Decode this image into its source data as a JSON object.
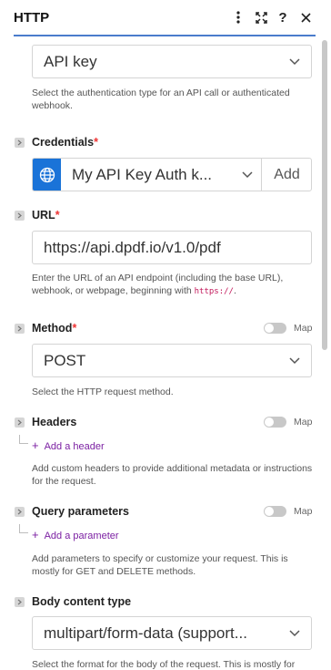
{
  "header": {
    "title": "HTTP",
    "icons": [
      "more-vertical-icon",
      "expand-icon",
      "help-icon",
      "close-icon"
    ],
    "accent_color": "#4a7ccc"
  },
  "auth_type": {
    "value": "API key",
    "help": "Select the authentication type for an API call or authenticated webhook."
  },
  "credentials": {
    "label": "Credentials",
    "required_mark": "*",
    "value": "My API Key Auth k...",
    "add_label": "Add",
    "icon_color": "#1a73d8"
  },
  "url": {
    "label": "URL",
    "required_mark": "*",
    "value": "https://api.dpdf.io/v1.0/pdf",
    "help_before": "Enter the URL of an API endpoint (including the base URL), webhook, or webpage, beginning with ",
    "help_code": "https://",
    "help_after": "."
  },
  "method": {
    "label": "Method",
    "required_mark": "*",
    "map_label": "Map",
    "value": "POST",
    "help": "Select the HTTP request method."
  },
  "headers": {
    "label": "Headers",
    "map_label": "Map",
    "add_label": "Add a header",
    "help": "Add custom headers to provide additional metadata or instructions for the request."
  },
  "query_parameters": {
    "label": "Query parameters",
    "map_label": "Map",
    "add_label": "Add a parameter",
    "help": "Add parameters to specify or customize your request. This is mostly for GET and DELETE methods."
  },
  "body_content_type": {
    "label": "Body content type",
    "value": "multipart/form-data (support...",
    "help": "Select the format for the body of the request. This is mostly for"
  }
}
